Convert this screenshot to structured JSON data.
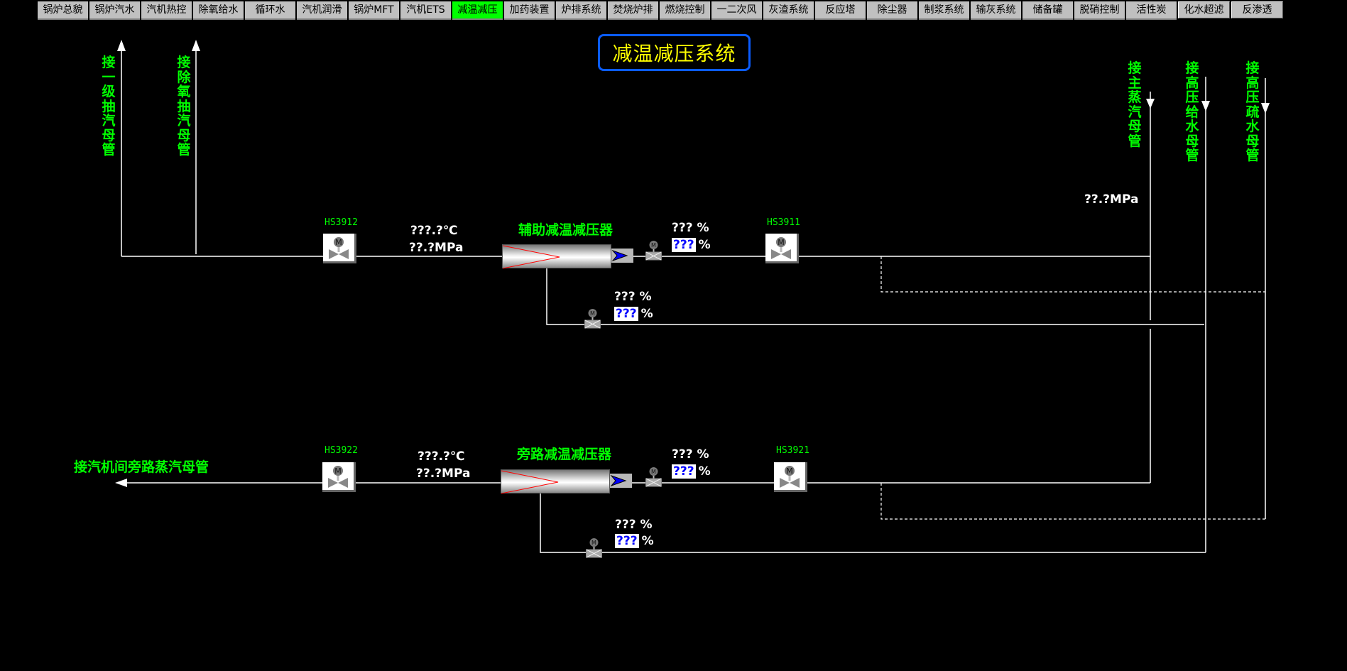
{
  "tabs": [
    {
      "label": "锅炉总貌"
    },
    {
      "label": "锅炉汽水"
    },
    {
      "label": "汽机热控"
    },
    {
      "label": "除氧给水"
    },
    {
      "label": "循环水"
    },
    {
      "label": "汽机润滑"
    },
    {
      "label": "锅炉MFT"
    },
    {
      "label": "汽机ETS"
    },
    {
      "label": "减温减压"
    },
    {
      "label": "加药装置"
    },
    {
      "label": "炉排系统"
    },
    {
      "label": "焚烧炉排"
    },
    {
      "label": "燃烧控制"
    },
    {
      "label": "一二次风"
    },
    {
      "label": "灰渣系统"
    },
    {
      "label": "反应塔"
    },
    {
      "label": "除尘器"
    },
    {
      "label": "制浆系统"
    },
    {
      "label": "输灰系统"
    },
    {
      "label": "储备罐"
    },
    {
      "label": "脱硝控制"
    },
    {
      "label": "活性炭"
    },
    {
      "label": "化水超滤"
    },
    {
      "label": "反渗透"
    }
  ],
  "active_tab": "减温减压",
  "title": "减温减压系统",
  "colors": {
    "background": "#000000",
    "label": "#00ff00",
    "title": "#ffff00",
    "title_border": "#0a5cff",
    "active_tab": "#00ff00",
    "value_box_text": "#0000ff"
  },
  "pipes": {
    "first_extraction": "接一级抽汽母管",
    "deaerator_extraction": "接除氧抽汽母管",
    "main_steam": "接主蒸汽母管",
    "hp_feedwater": "接高压给水母管",
    "hp_drain": "接高压疏水母管",
    "turbine_bypass": "接汽机间旁路蒸汽母管"
  },
  "main_steam_pressure": "??.?MPa",
  "aux": {
    "name": "辅助减温减压器",
    "inlet_valve": "HS3912",
    "outlet_valve": "HS3911",
    "temperature": "???.?℃",
    "pressure": "??.?MPa",
    "steam_valve": {
      "feedback": "???",
      "setpoint": "???",
      "unit": "%"
    },
    "water_valve": {
      "feedback": "???",
      "setpoint": "???",
      "unit": "%"
    }
  },
  "bypass": {
    "name": "旁路减温减压器",
    "inlet_valve": "HS3922",
    "outlet_valve": "HS3921",
    "temperature": "???.?℃",
    "pressure": "??.?MPa",
    "steam_valve": {
      "feedback": "???",
      "setpoint": "???",
      "unit": "%"
    },
    "water_valve": {
      "feedback": "???",
      "setpoint": "???",
      "unit": "%"
    }
  }
}
